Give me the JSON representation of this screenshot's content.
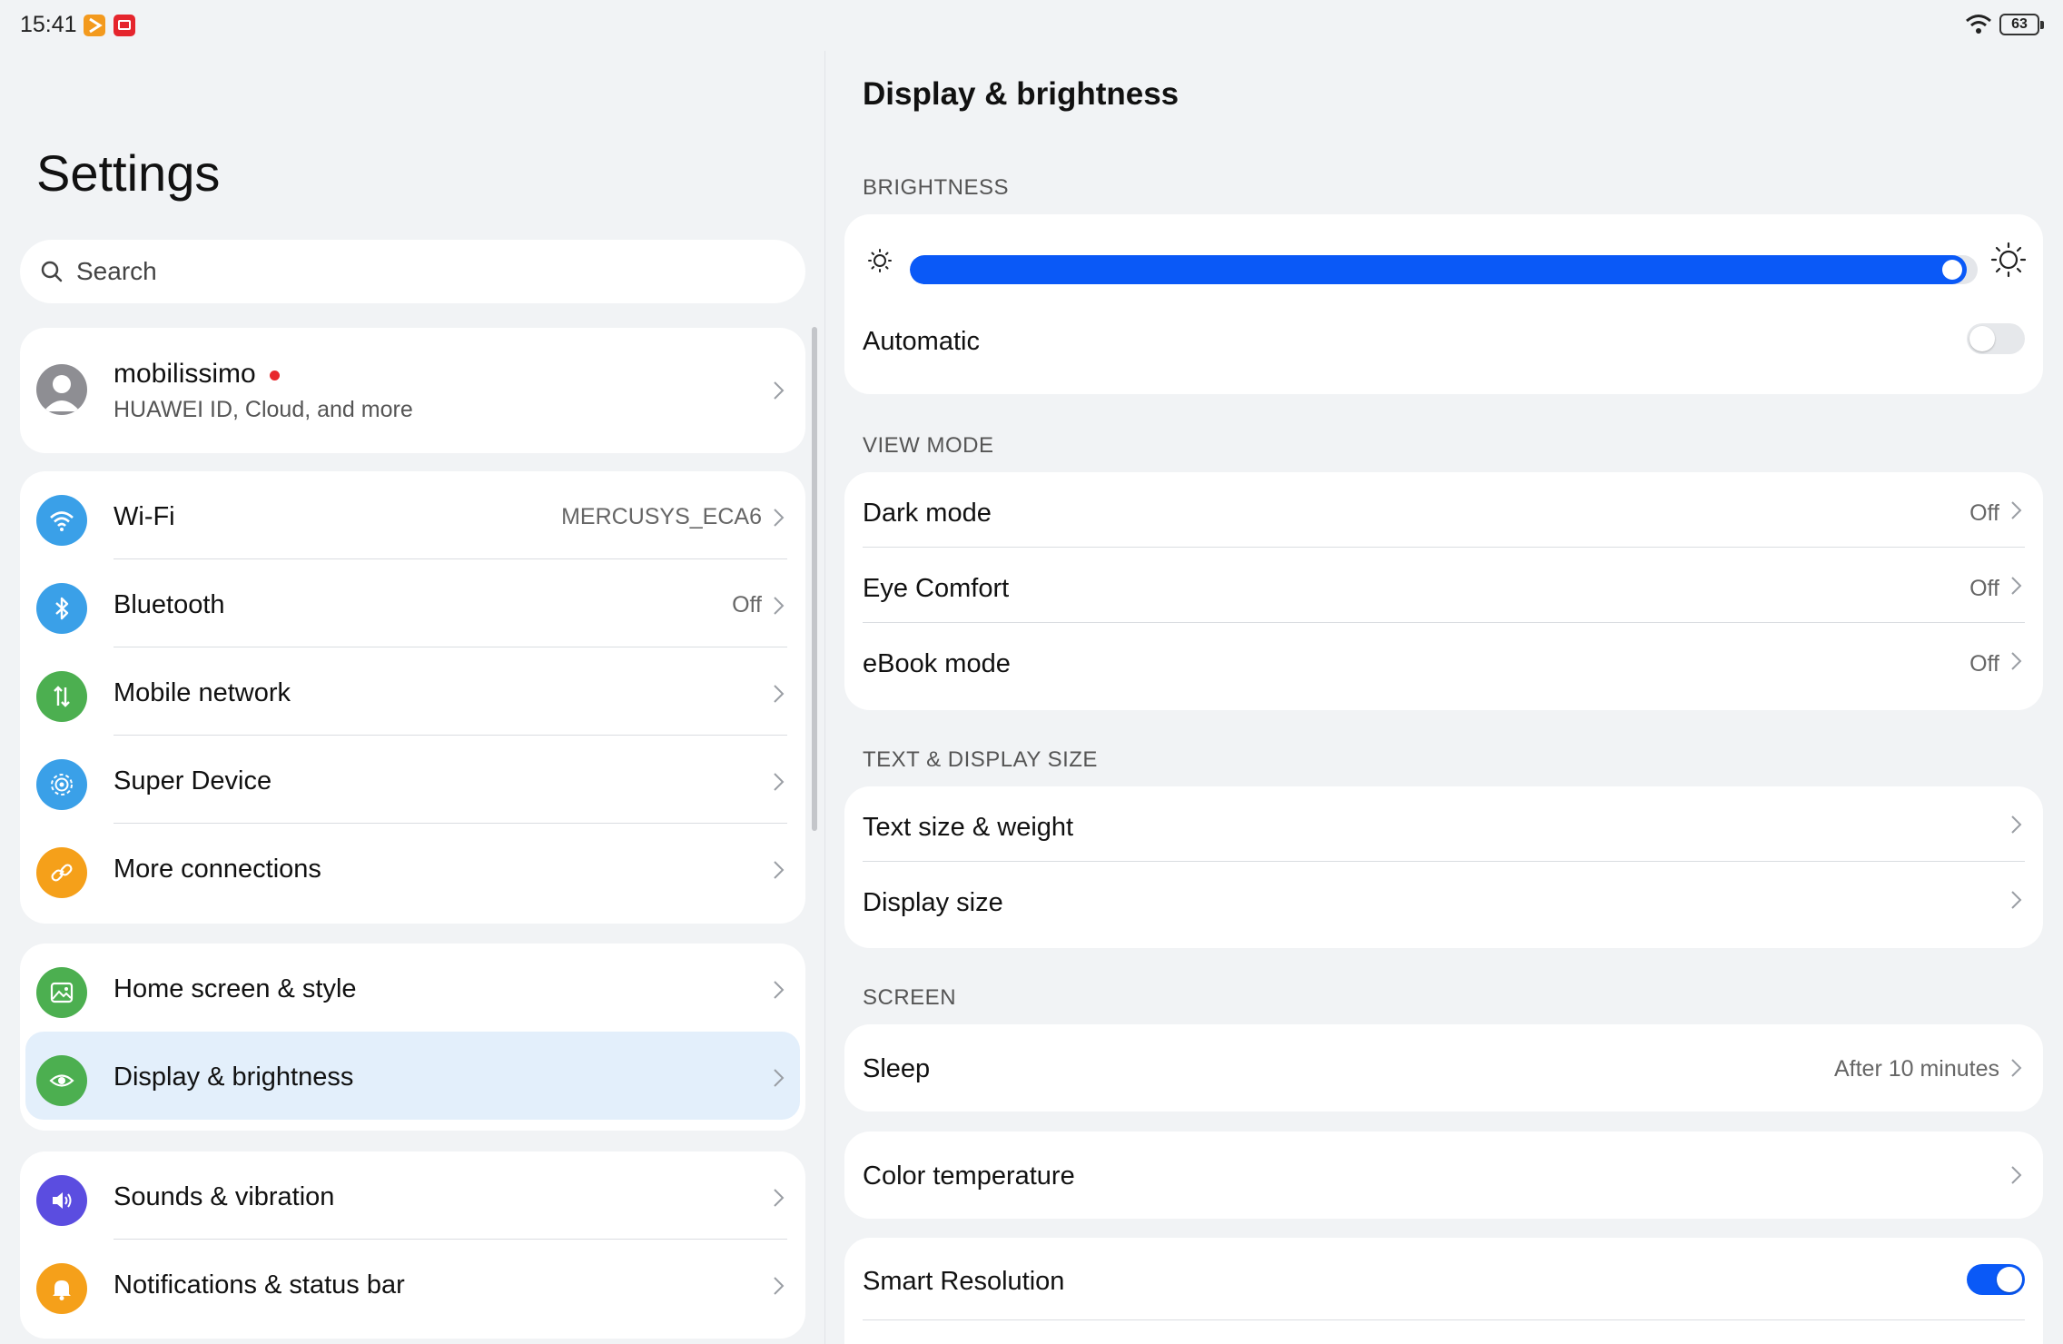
{
  "status_bar": {
    "time": "15:41",
    "battery": "63",
    "icons": [
      "app-notification-icon",
      "app-notification-icon",
      "wifi-icon",
      "battery-icon"
    ]
  },
  "left": {
    "title": "Settings",
    "search_placeholder": "Search",
    "profile": {
      "name": "mobilissimo",
      "subtitle": "HUAWEI ID, Cloud, and more"
    },
    "connections": [
      {
        "label": "Wi-Fi",
        "value": "MERCUSYS_ECA6",
        "icon": "wifi-icon",
        "color": "#3aa0e8"
      },
      {
        "label": "Bluetooth",
        "value": "Off",
        "icon": "bluetooth-icon",
        "color": "#3aa0e8"
      },
      {
        "label": "Mobile network",
        "value": "",
        "icon": "mobile-data-icon",
        "color": "#4caf50"
      },
      {
        "label": "Super Device",
        "value": "",
        "icon": "super-device-icon",
        "color": "#3aa0e8"
      },
      {
        "label": "More connections",
        "value": "",
        "icon": "link-icon",
        "color": "#f5a01a"
      }
    ],
    "personalization": [
      {
        "label": "Home screen & style",
        "icon": "image-icon",
        "color": "#4caf50"
      },
      {
        "label": "Display & brightness",
        "icon": "eye-icon",
        "color": "#4caf50",
        "selected": true
      }
    ],
    "sound": [
      {
        "label": "Sounds & vibration",
        "icon": "speaker-icon",
        "color": "#5b4de0"
      },
      {
        "label": "Notifications & status bar",
        "icon": "bell-icon",
        "color": "#f5a01a"
      }
    ]
  },
  "right": {
    "title": "Display & brightness",
    "brightness": {
      "section": "BRIGHTNESS",
      "level": 0.99,
      "automatic_label": "Automatic",
      "automatic_on": false
    },
    "view_mode": {
      "section": "VIEW MODE",
      "items": [
        {
          "label": "Dark mode",
          "value": "Off"
        },
        {
          "label": "Eye Comfort",
          "value": "Off"
        },
        {
          "label": "eBook mode",
          "value": "Off"
        }
      ]
    },
    "text_display": {
      "section": "TEXT & DISPLAY SIZE",
      "items": [
        {
          "label": "Text size & weight"
        },
        {
          "label": "Display size"
        }
      ]
    },
    "screen": {
      "section": "SCREEN",
      "sleep_label": "Sleep",
      "sleep_value": "After 10 minutes",
      "color_temp_label": "Color temperature",
      "smart_resolution_label": "Smart Resolution",
      "smart_resolution_on": true
    },
    "colors": {
      "accent": "#0a59f7",
      "selected_bg": "#e3effb",
      "background": "#f1f3f5"
    }
  }
}
